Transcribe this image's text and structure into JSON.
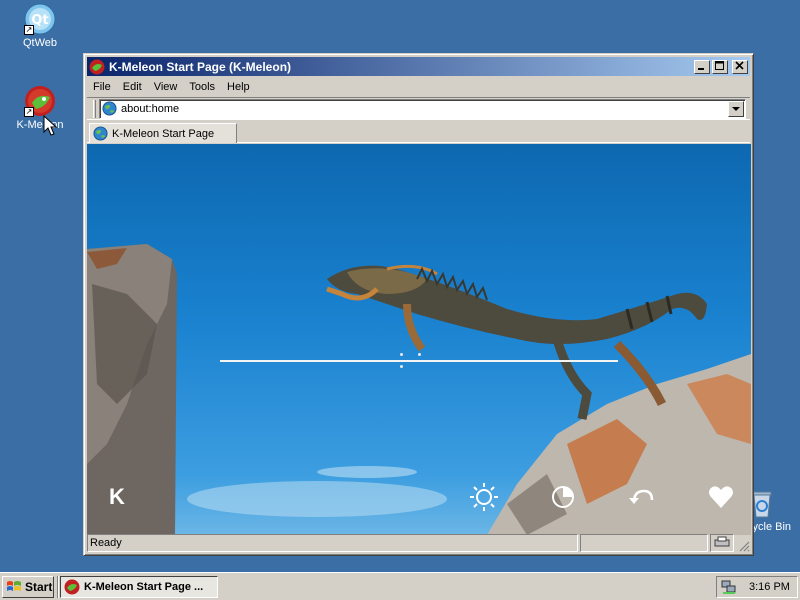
{
  "desktop": {
    "icons": [
      {
        "label": "QtWeb",
        "icon": "qtweb-icon"
      },
      {
        "label": "K-Meleon",
        "icon": "kmeleon-icon"
      },
      {
        "label": "Recycle Bin",
        "icon": "recycle-bin-icon"
      }
    ],
    "background_color": "#3a6ea5"
  },
  "window": {
    "title": "K-Meleon Start Page (K-Meleon)",
    "menu": [
      "File",
      "Edit",
      "View",
      "Tools",
      "Help"
    ],
    "address": "about:home",
    "tab_label": "K-Meleon Start Page",
    "status_text": "Ready",
    "content": {
      "logo_letter": "K",
      "bottom_icons": [
        "sun-icon",
        "pie-timer-icon",
        "undo-arrow-icon",
        "heart-icon"
      ]
    }
  },
  "taskbar": {
    "start_label": "Start",
    "task_label": "K-Meleon Start Page ...",
    "clock": "3:16 PM"
  },
  "colors": {
    "titlebar_start": "#0a246a",
    "titlebar_end": "#a6caf0",
    "sky": "#1a82d0"
  }
}
